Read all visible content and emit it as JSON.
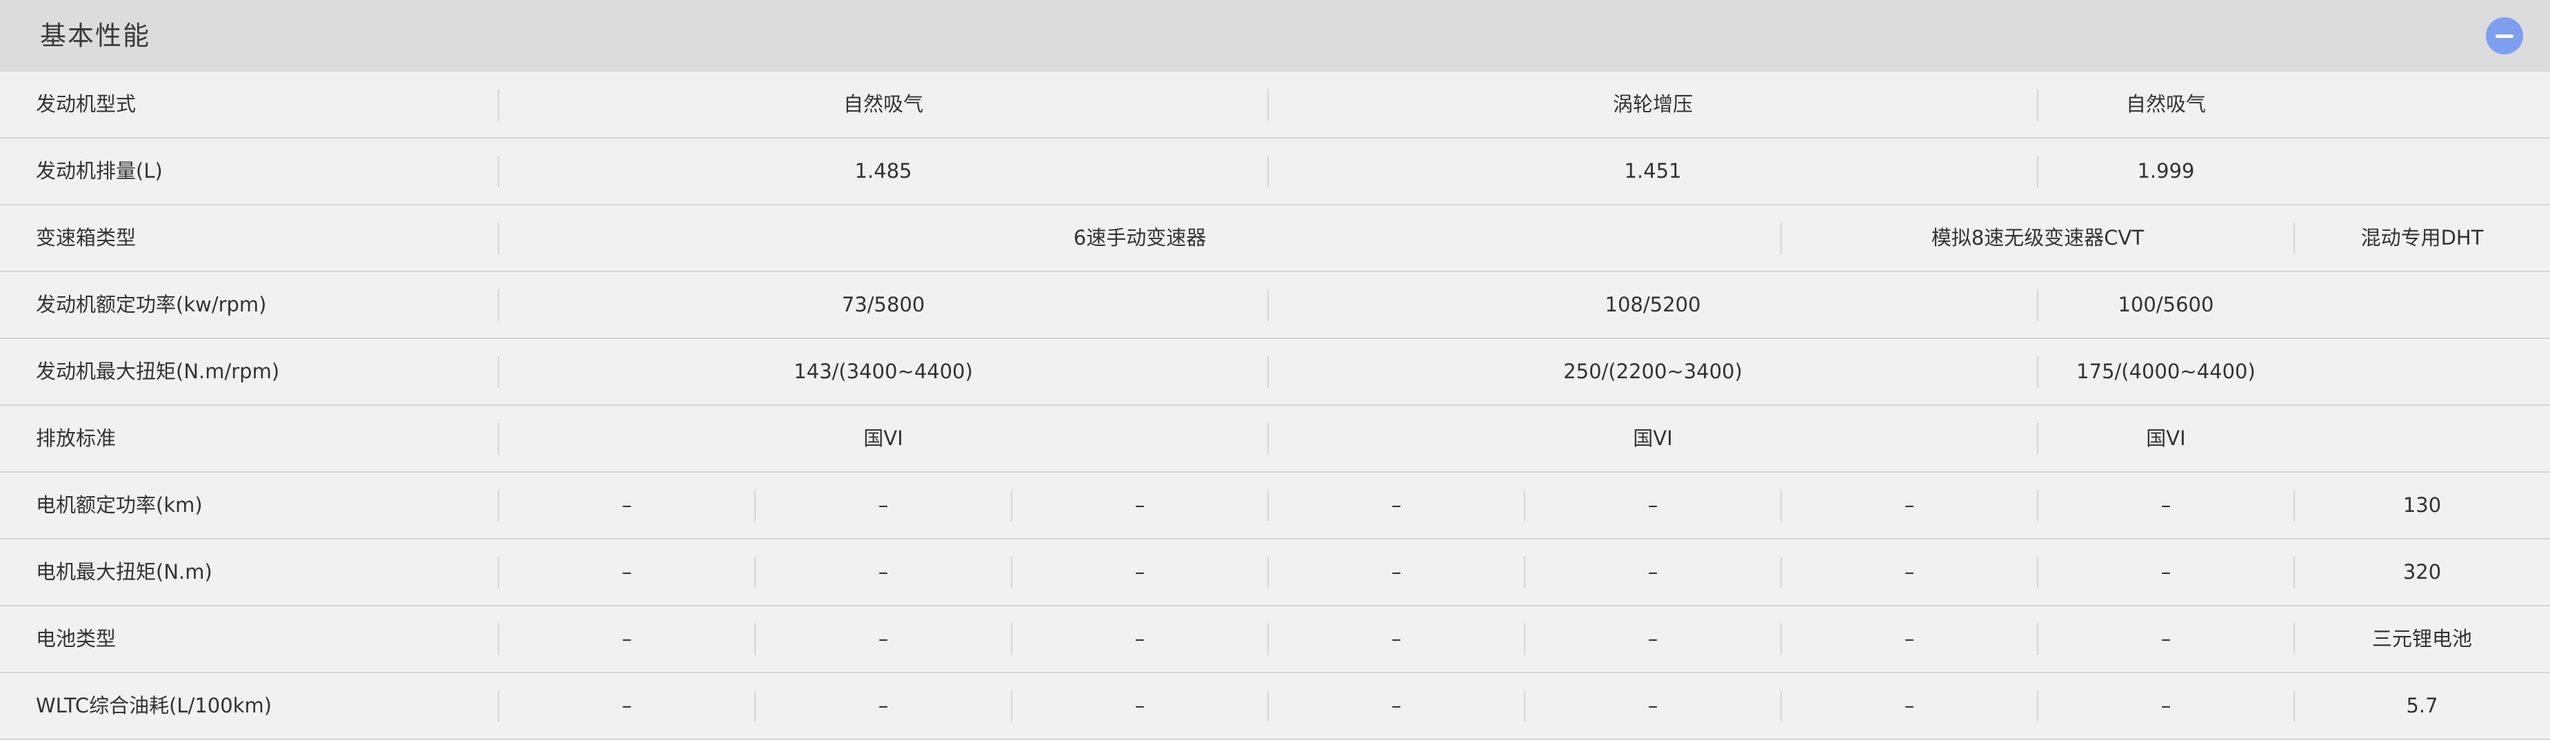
{
  "section": {
    "title": "基本性能",
    "collapse_icon": "minus-circle-icon",
    "accent_color": "#7e9ff0"
  },
  "rows": [
    {
      "label": "发动机型式",
      "spans": [
        3,
        3,
        1
      ],
      "cells": [
        "自然吸气",
        "涡轮增压",
        "自然吸气"
      ]
    },
    {
      "label": "发动机排量(L)",
      "spans": [
        3,
        3,
        1
      ],
      "cells": [
        "1.485",
        "1.451",
        "1.999"
      ]
    },
    {
      "label": "变速箱类型",
      "spans": [
        5,
        2,
        1
      ],
      "cells": [
        "6速手动变速器",
        "模拟8速无级变速器CVT",
        "混动专用DHT"
      ]
    },
    {
      "label": "发动机额定功率(kw/rpm)",
      "spans": [
        3,
        3,
        1
      ],
      "cells": [
        "73/5800",
        "108/5200",
        "100/5600"
      ]
    },
    {
      "label": "发动机最大扭矩(N.m/rpm)",
      "spans": [
        3,
        3,
        1
      ],
      "cells": [
        "143/(3400~4400)",
        "250/(2200~3400)",
        "175/(4000~4400)"
      ]
    },
    {
      "label": "排放标准",
      "spans": [
        3,
        3,
        1
      ],
      "cells": [
        "国VI",
        "国VI",
        "国VI"
      ]
    },
    {
      "label": "电机额定功率(km)",
      "spans": [
        1,
        1,
        1,
        1,
        1,
        1,
        1,
        1
      ],
      "cells": [
        "–",
        "–",
        "–",
        "–",
        "–",
        "–",
        "–",
        "130"
      ]
    },
    {
      "label": "电机最大扭矩(N.m)",
      "spans": [
        1,
        1,
        1,
        1,
        1,
        1,
        1,
        1
      ],
      "cells": [
        "–",
        "–",
        "–",
        "–",
        "–",
        "–",
        "–",
        "320"
      ]
    },
    {
      "label": "电池类型",
      "spans": [
        1,
        1,
        1,
        1,
        1,
        1,
        1,
        1
      ],
      "cells": [
        "–",
        "–",
        "–",
        "–",
        "–",
        "–",
        "–",
        "三元锂电池"
      ]
    },
    {
      "label": "WLTC综合油耗(L/100km)",
      "spans": [
        1,
        1,
        1,
        1,
        1,
        1,
        1,
        1
      ],
      "cells": [
        "–",
        "–",
        "–",
        "–",
        "–",
        "–",
        "–",
        "5.7"
      ]
    }
  ]
}
